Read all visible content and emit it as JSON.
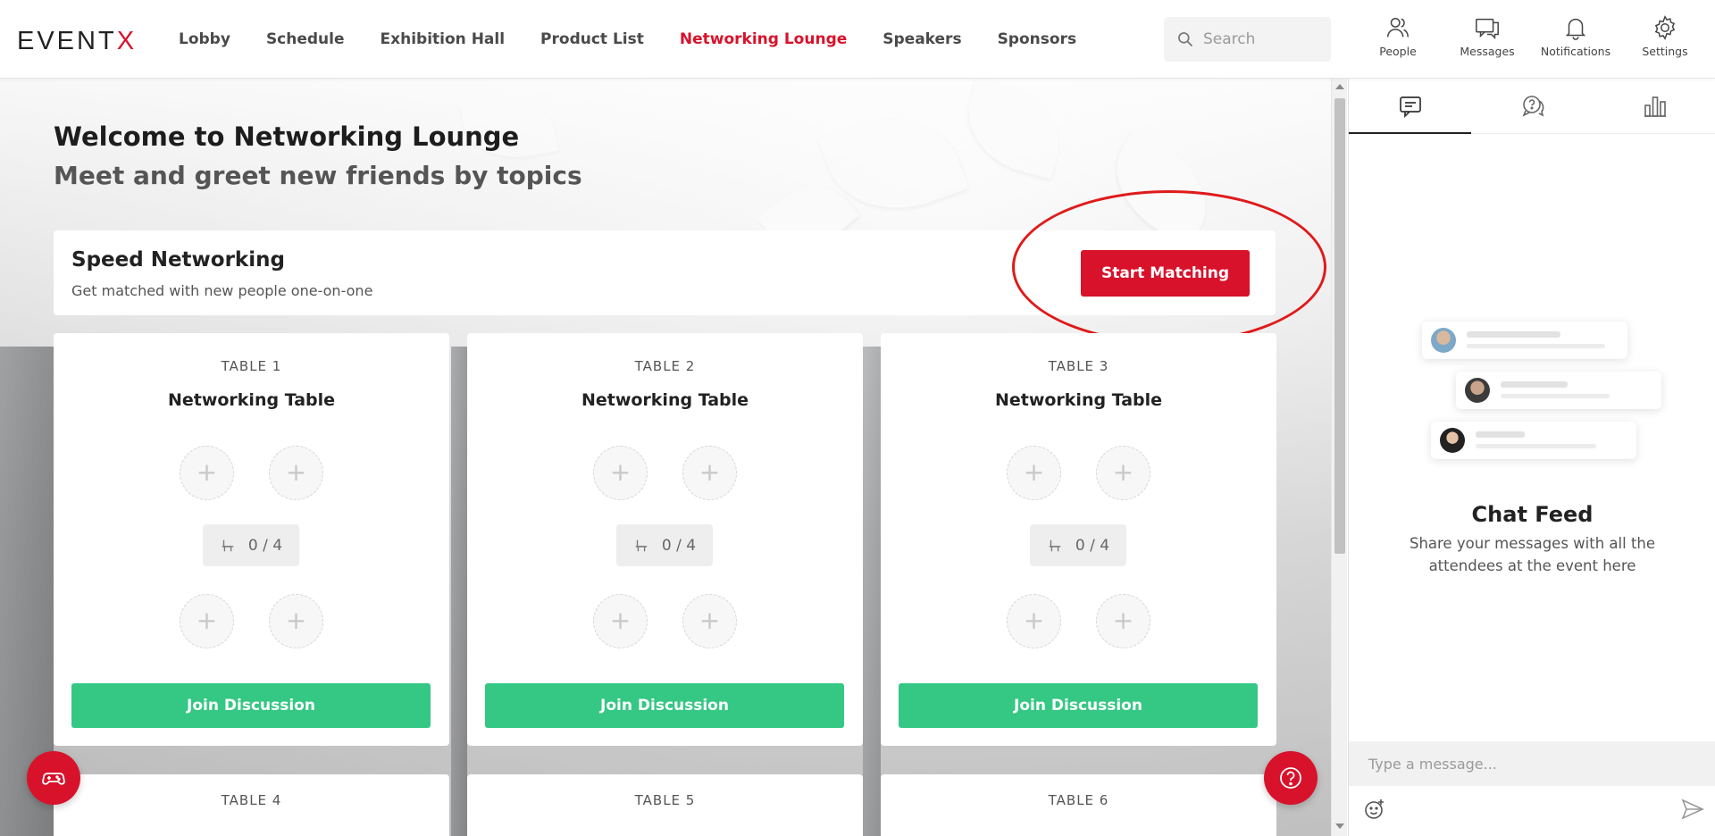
{
  "app": {
    "logo_text": "EVENT",
    "logo_accent": "X",
    "brand_color": "#d8122b",
    "join_color": "#35c784"
  },
  "nav": {
    "items": [
      {
        "label": "Lobby",
        "active": false
      },
      {
        "label": "Schedule",
        "active": false
      },
      {
        "label": "Exhibition Hall",
        "active": false
      },
      {
        "label": "Product List",
        "active": false
      },
      {
        "label": "Networking Lounge",
        "active": true
      },
      {
        "label": "Speakers",
        "active": false
      },
      {
        "label": "Sponsors",
        "active": false
      }
    ]
  },
  "search": {
    "placeholder": "Search"
  },
  "header_actions": [
    {
      "label": "People",
      "icon": "people-icon"
    },
    {
      "label": "Messages",
      "icon": "messages-icon"
    },
    {
      "label": "Notifications",
      "icon": "bell-icon"
    },
    {
      "label": "Settings",
      "icon": "gear-icon"
    }
  ],
  "lounge": {
    "title": "Welcome to Networking Lounge",
    "subtitle": "Meet and greet new friends by topics"
  },
  "speed_networking": {
    "title": "Speed Networking",
    "subtitle": "Get matched with new people one-on-one",
    "button_label": "Start Matching"
  },
  "tables": [
    {
      "label": "TABLE 1",
      "name": "Networking Table",
      "capacity": "0 / 4",
      "button_label": "Join Discussion"
    },
    {
      "label": "TABLE 2",
      "name": "Networking Table",
      "capacity": "0 / 4",
      "button_label": "Join Discussion"
    },
    {
      "label": "TABLE 3",
      "name": "Networking Table",
      "capacity": "0 / 4",
      "button_label": "Join Discussion"
    },
    {
      "label": "TABLE 4"
    },
    {
      "label": "TABLE 5"
    },
    {
      "label": "TABLE 6"
    }
  ],
  "seat_symbol": "+",
  "side_panel": {
    "tabs": [
      {
        "icon": "chat-feed-icon",
        "active": true
      },
      {
        "icon": "qa-icon",
        "active": false
      },
      {
        "icon": "poll-icon",
        "active": false
      }
    ],
    "feed_title": "Chat Feed",
    "feed_description": "Share your messages with all the attendees at the event here",
    "message_placeholder": "Type a message..."
  }
}
